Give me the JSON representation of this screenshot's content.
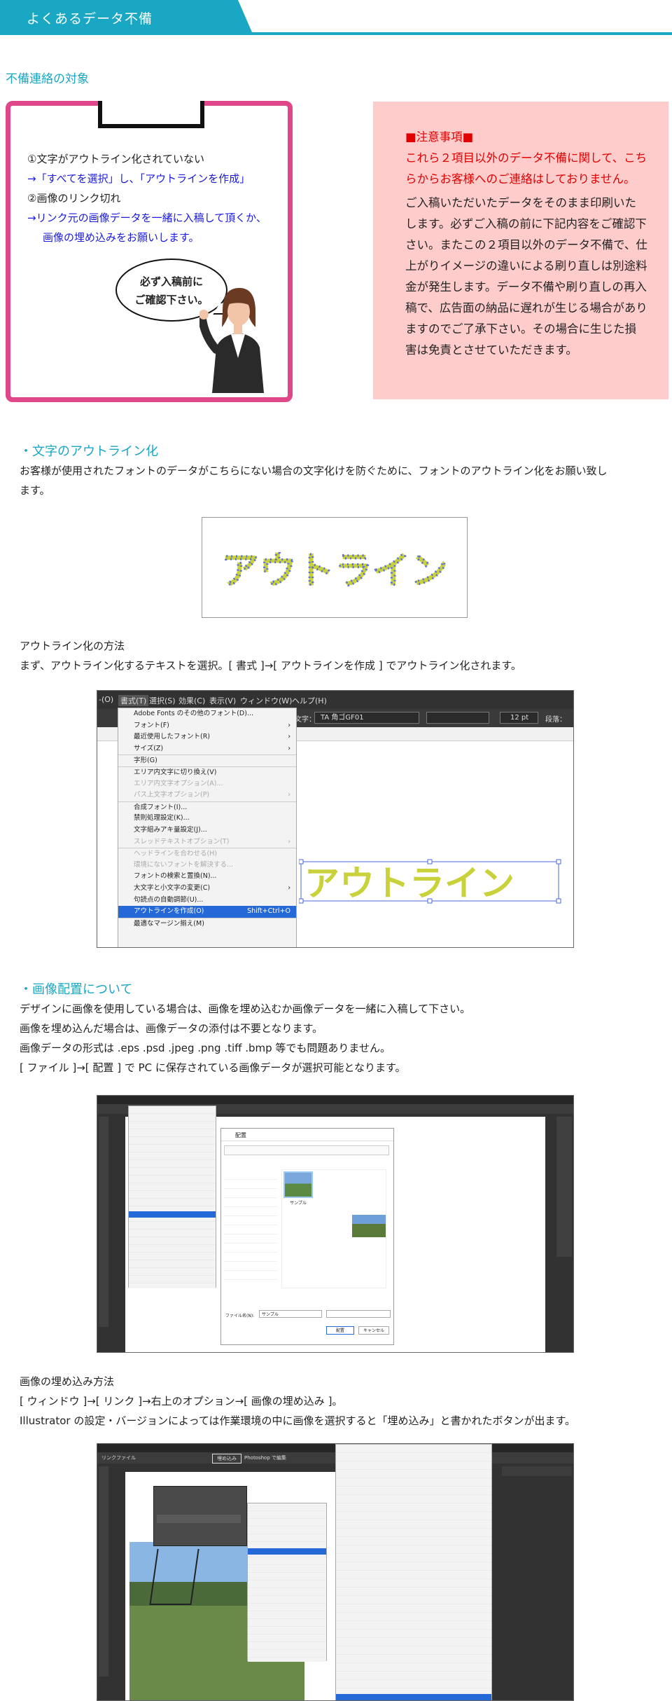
{
  "header": {
    "title": "よくあるデータ不備"
  },
  "section_title": "不備連絡の対象",
  "checklist": {
    "line1": "①文字がアウトライン化されていない",
    "line2": "→「すべてを選択」し、「アウトラインを作成」",
    "line3": "②画像のリンク切れ",
    "line4": "→リンク元の画像データを一緒に入稿して頂くか、",
    "line5": "画像の埋め込みをお願いします。",
    "bubble1": "必ず入稿前に",
    "bubble2": "ご確認下さい。"
  },
  "note": {
    "title": "■注意事項■",
    "red_text": "これら２項目以外のデータ不備に関して、こちらからお客様へのご連絡はしておりません。",
    "body": "ご入稿いただいたデータをそのまま印刷いたします。必ずご入稿の前に下記内容をご確認下さい。またこの２項目以外のデータ不備で、仕上がりイメージの違いによる刷り直しは別途料金が発生します。データ不備や刷り直しの再入稿で、広告面の納品に遅れが生じる場合がありますのでご了承下さい。その場合に生じた損害は免責とさせていただきます。"
  },
  "outline": {
    "heading": "・文字のアウトライン化",
    "desc1": "お客様が使用されたフォントのデータがこちらにない場合の文字化けを防ぐために、フォントのアウトライン化をお願い致し",
    "desc2": "ます。",
    "sample": "アウトライン",
    "method_title": "アウトライン化の方法",
    "method_desc": "まず、アウトライン化するテキストを選択。[ 書式 ]→[ アウトラインを作成 ] でアウトライン化されます。"
  },
  "shot1": {
    "menubar": [
      "-(O)",
      "書式(T)",
      "選択(S)",
      "効果(C)",
      "表示(V)",
      "ウィンドウ(W)",
      "ヘルプ(H)"
    ],
    "items": [
      {
        "t": "Adobe Fonts のその他のフォント(D)...",
        "s": ""
      },
      {
        "t": "フォント(F)",
        "s": "›"
      },
      {
        "t": "最近使用したフォント(R)",
        "s": "›"
      },
      {
        "t": "サイズ(Z)",
        "s": "›"
      },
      {
        "t": "字形(G)",
        "s": ""
      },
      {
        "t": "エリア内文字に切り換え(V)",
        "s": ""
      },
      {
        "t": "エリア内文字オプション(A)...",
        "s": ""
      },
      {
        "t": "パス上文字オプション(P)",
        "s": "›"
      },
      {
        "t": "合成フォント(I)...",
        "s": ""
      },
      {
        "t": "禁則処理設定(K)...",
        "s": ""
      },
      {
        "t": "文字組みアキ量設定(J)...",
        "s": ""
      },
      {
        "t": "スレッドテキストオプション(T)",
        "s": "›"
      },
      {
        "t": "ヘッドラインを合わせる(H)",
        "s": ""
      },
      {
        "t": "環境にないフォントを解決する...",
        "s": ""
      },
      {
        "t": "フォントの検索と置換(N)...",
        "s": ""
      },
      {
        "t": "大文字と小文字の変更(C)",
        "s": "›"
      },
      {
        "t": "句読点の自動調節(U)...",
        "s": ""
      },
      {
        "t": "アウトラインを作成(O)",
        "s": "Shift+Ctrl+O"
      },
      {
        "t": "最適なマージン揃え(M)",
        "s": ""
      }
    ],
    "font_label": "文字：",
    "font_name": "TA 角ゴGF01",
    "font_size": "12 pt",
    "para_label": "段落：",
    "sample": "アウトライン"
  },
  "image": {
    "heading": "・画像配置について",
    "p1": "デザインに画像を使用している場合は、画像を埋め込むか画像データを一緒に入稿して下さい。",
    "p2": "画像を埋め込んだ場合は、画像データの添付は不要となります。",
    "p3": "画像データの形式は .eps .psd .jpeg .png .tiff .bmp 等でも問題ありません。",
    "p4": "[ ファイル ]→[ 配置 ] で PC に保存されている画像データが選択可能となります。",
    "dialog_title": "配置",
    "file_label": "ファイル名(N):",
    "file_name": "サンプル",
    "thumb_label": "サンプル",
    "place_button": "配置",
    "cancel_button": "キャンセル",
    "embed_title": "画像の埋め込み方法",
    "embed1": "[ ウィンドウ ]→[ リンク ]→右上のオプション→[ 画像の埋め込み ]。",
    "embed2": "Illustrator の設定・バージョンによっては作業環境の中に画像を選択すると「埋め込み」と書かれたボタンが出ます。",
    "link_panel": "リンクファイル",
    "embed_button": "埋め込み",
    "photoshop_edit": "Photoshop で編集"
  }
}
